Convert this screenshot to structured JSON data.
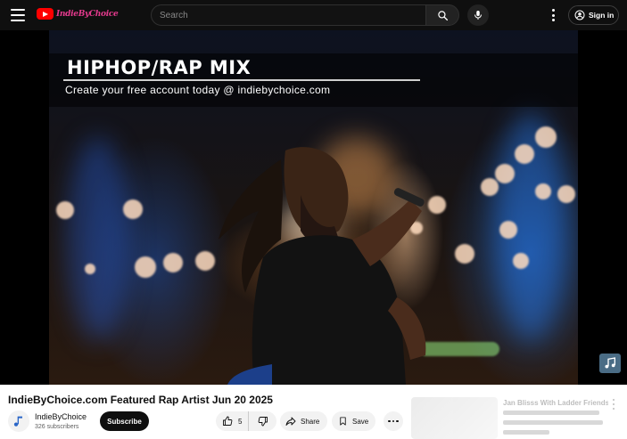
{
  "masthead": {
    "logo_text": "IndieByChoice",
    "search_placeholder": "Search",
    "signin_label": "Sign in"
  },
  "player": {
    "banner_title": "HIPHOP/RAP MIX",
    "banner_subtitle": "Create your free account today @ indiebychoice.com"
  },
  "video": {
    "title": "IndieByChoice.com Featured Rap Artist Jun 20 2025",
    "channel_name": "IndieByChoice",
    "subscribers": "326 subscribers",
    "subscribe_label": "Subscribe",
    "likes": "5",
    "share_label": "Share",
    "save_label": "Save"
  },
  "recommendation": {
    "title": "Jan Blisss With Ladder Friends"
  },
  "colors": {
    "masthead_bg": "#0f0f0f",
    "brand_red": "#ff0000",
    "logo_pink": "#e43a8d",
    "subscribe_bg": "#0f0f0f",
    "pill_bg": "#f2f2f2"
  },
  "icons": [
    "menu-icon",
    "youtube-logo-icon",
    "search-icon",
    "microphone-icon",
    "more-vert-icon",
    "account-icon",
    "music-note-icon",
    "thumb-up-icon",
    "thumb-down-icon",
    "share-icon",
    "bookmark-icon",
    "more-horiz-icon"
  ]
}
